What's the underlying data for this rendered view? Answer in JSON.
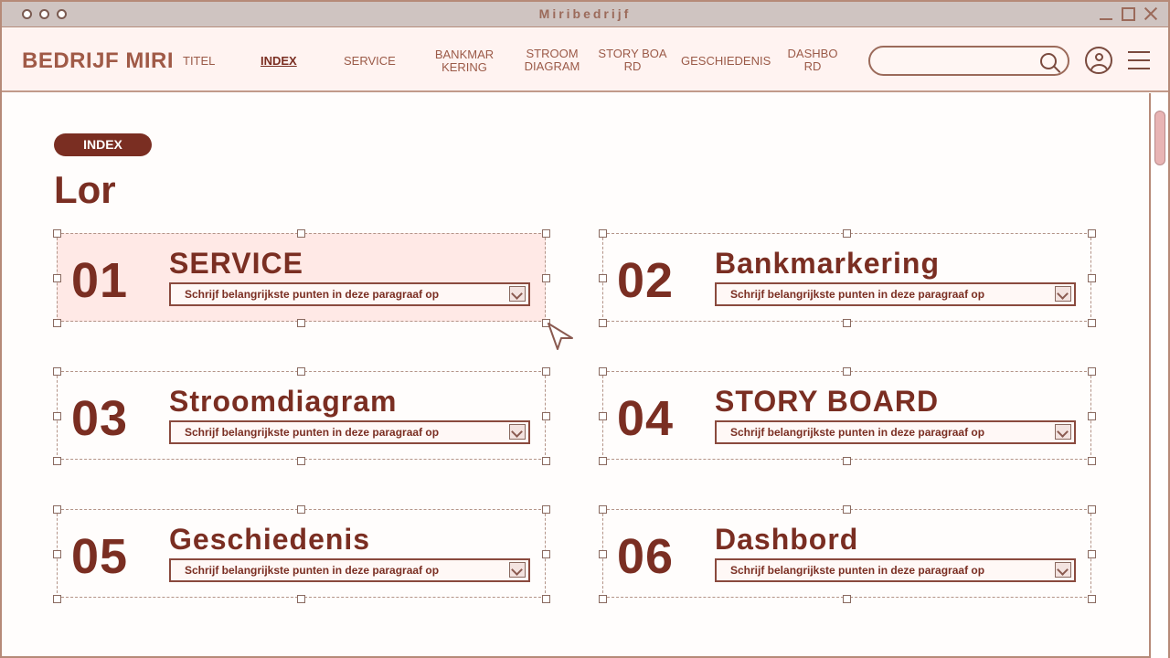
{
  "window": {
    "title": "Miribedrijf"
  },
  "nav": {
    "brand": "BEDRIJF MIRI",
    "links": [
      {
        "label": "TITEL"
      },
      {
        "label": "INDEX"
      },
      {
        "label": "SERVICE"
      },
      {
        "label_line1": "BANKMAR",
        "label_line2": "KERING"
      },
      {
        "label_line1": "STROOM",
        "label_line2": "DIAGRAM"
      },
      {
        "label_line1": "STORY BOA",
        "label_line2": "RD"
      },
      {
        "label": "GESCHIEDENIS"
      },
      {
        "label_line1": "DASHBO",
        "label_line2": "RD"
      }
    ],
    "search": {
      "placeholder": "",
      "value": ""
    }
  },
  "page": {
    "badge": "INDEX",
    "title": "Lor"
  },
  "cards": [
    {
      "number": "01",
      "title": "SERVICE",
      "dropdown": "Schrijf belangrijkste punten in deze paragraaf op"
    },
    {
      "number": "02",
      "title": "Bankmarkering",
      "dropdown": "Schrijf belangrijkste punten in deze paragraaf op"
    },
    {
      "number": "03",
      "title": "Stroomdiagram",
      "dropdown": "Schrijf belangrijkste punten in deze paragraaf op"
    },
    {
      "number": "04",
      "title": "STORY BOARD",
      "dropdown": "Schrijf belangrijkste punten in deze paragraaf op"
    },
    {
      "number": "05",
      "title": "Geschiedenis",
      "dropdown": "Schrijf belangrijkste punten in deze paragraaf op"
    },
    {
      "number": "06",
      "title": "Dashbord",
      "dropdown": "Schrijf belangrijkste punten in deze paragraaf op"
    }
  ],
  "colors": {
    "accent": "#7a2e22",
    "nav_bg": "#fff3f1",
    "highlight": "#ffe9e6"
  }
}
